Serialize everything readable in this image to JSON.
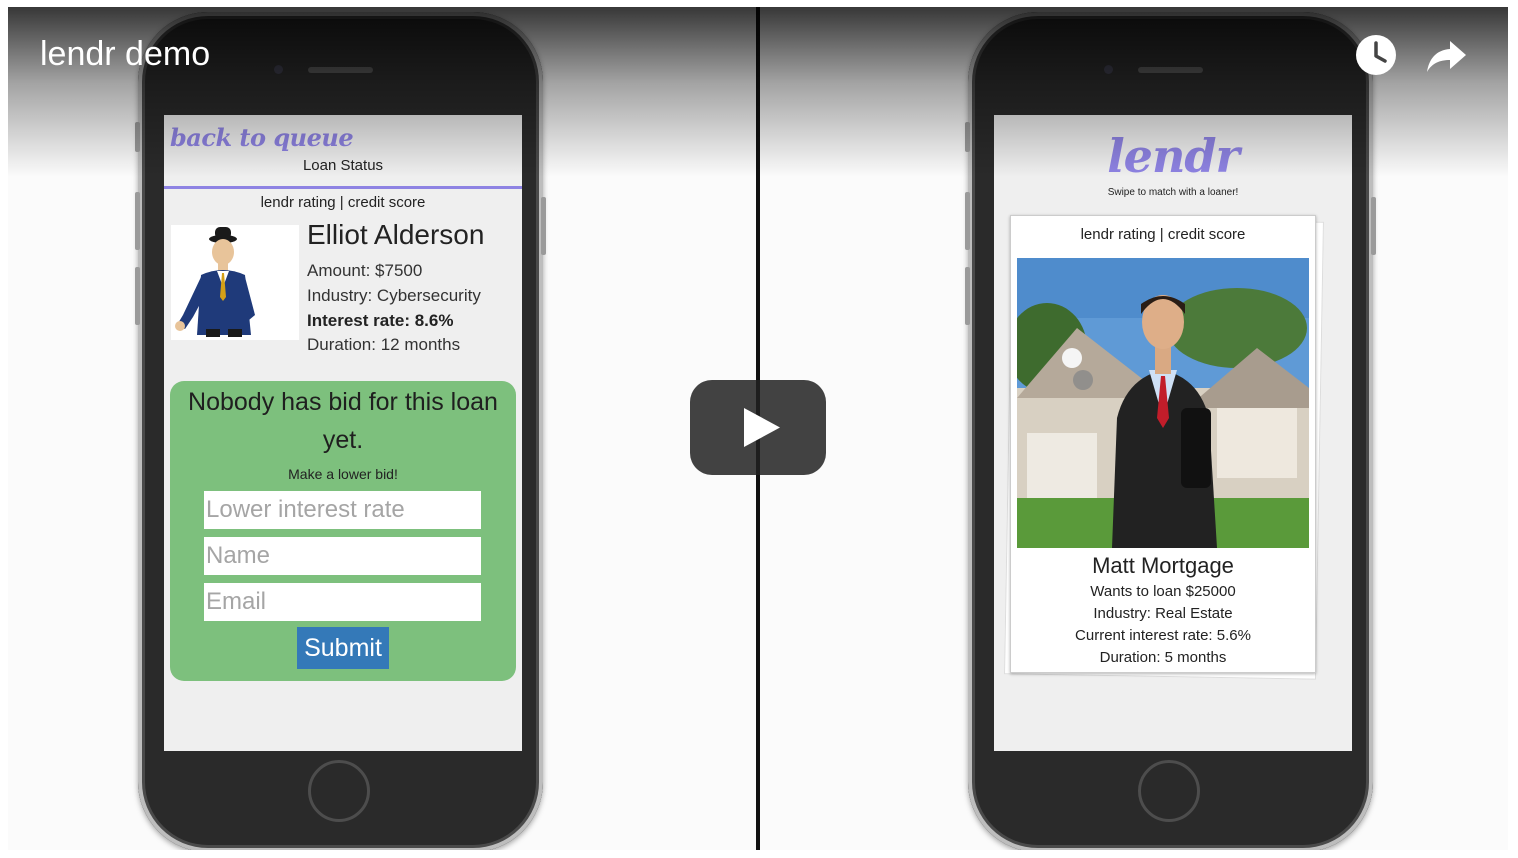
{
  "video": {
    "title": "lendr demo",
    "top_icons": [
      "clock-icon",
      "share-icon"
    ],
    "play_icon": "play-icon"
  },
  "left_screen": {
    "back_link": "back to queue",
    "heading": "Loan Status",
    "rating_label": "lendr rating | credit score",
    "borrower": {
      "name": "Elliot Alderson",
      "amount": "Amount: $7500",
      "industry": "Industry: Cybersecurity",
      "interest_rate": "Interest rate: 8.6%",
      "duration": "Duration: 12 months"
    },
    "bid": {
      "title": "Nobody has bid for this loan yet.",
      "subtitle": "Make a lower bid!",
      "rate_placeholder": "Lower interest rate",
      "name_placeholder": "Name",
      "email_placeholder": "Email",
      "submit_label": "Submit"
    }
  },
  "right_screen": {
    "logo": "lendr",
    "tagline": "Swipe to match with a loaner!",
    "card": {
      "rating_label": "lendr rating | credit score",
      "name": "Matt Mortgage",
      "wants": "Wants to loan $25000",
      "industry": "Industry: Real Estate",
      "interest_rate": "Current interest rate: 5.6%",
      "duration": "Duration: 5 months"
    }
  },
  "colors": {
    "accent_purple": "#8e83e3",
    "bid_green": "#7dc07d",
    "submit_blue": "#3479b8",
    "phone_body": "#2a2a2a"
  }
}
